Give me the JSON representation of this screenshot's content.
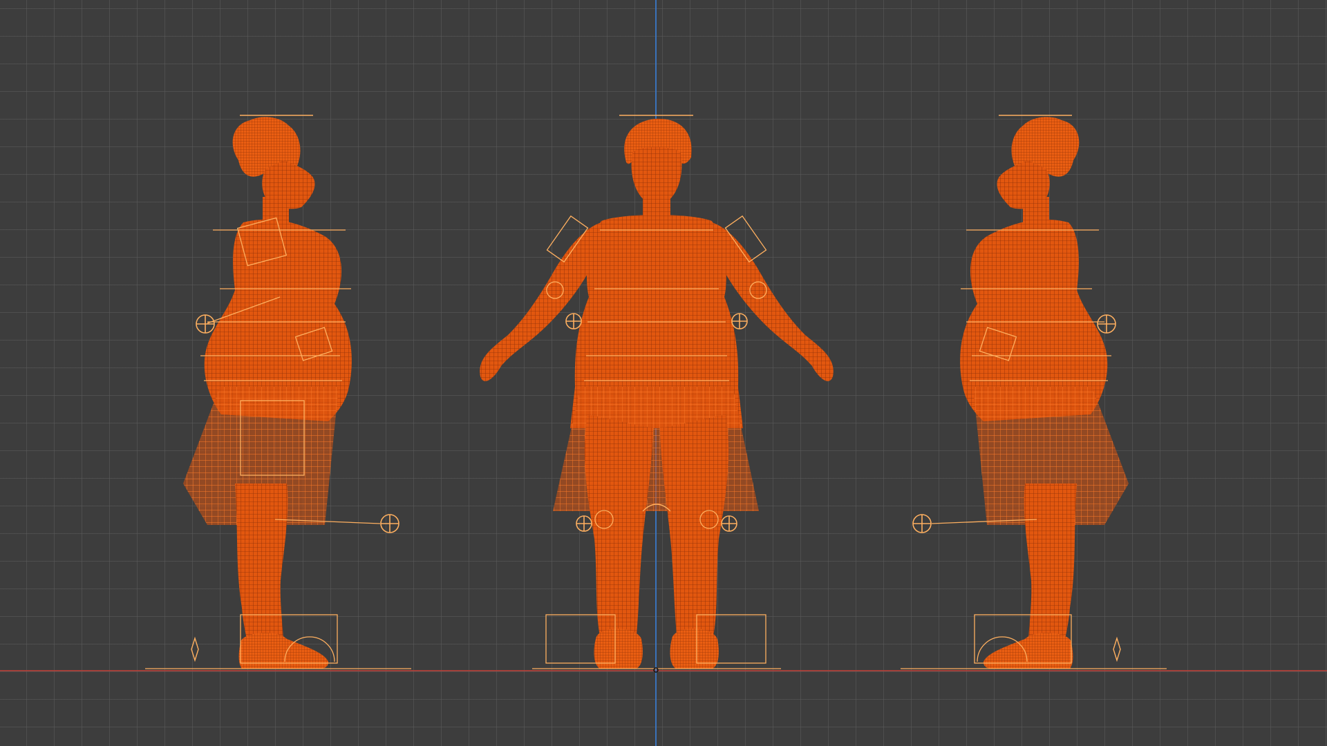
{
  "viewport": {
    "view": "orthographic-front",
    "mode": "wireframe",
    "selection": "character-mesh-and-armature"
  },
  "colors": {
    "background": "#3d3d3d",
    "grid": "#5a5a5a",
    "axis_x": "#b5413a",
    "axis_z": "#3a78c8",
    "wire": "#ff6414",
    "wire_dark": "#c8440a",
    "rig": "#ffb060"
  },
  "figures": [
    {
      "name": "figure-side-left",
      "facing": "right"
    },
    {
      "name": "figure-front",
      "facing": "front"
    },
    {
      "name": "figure-side-right",
      "facing": "left"
    }
  ]
}
